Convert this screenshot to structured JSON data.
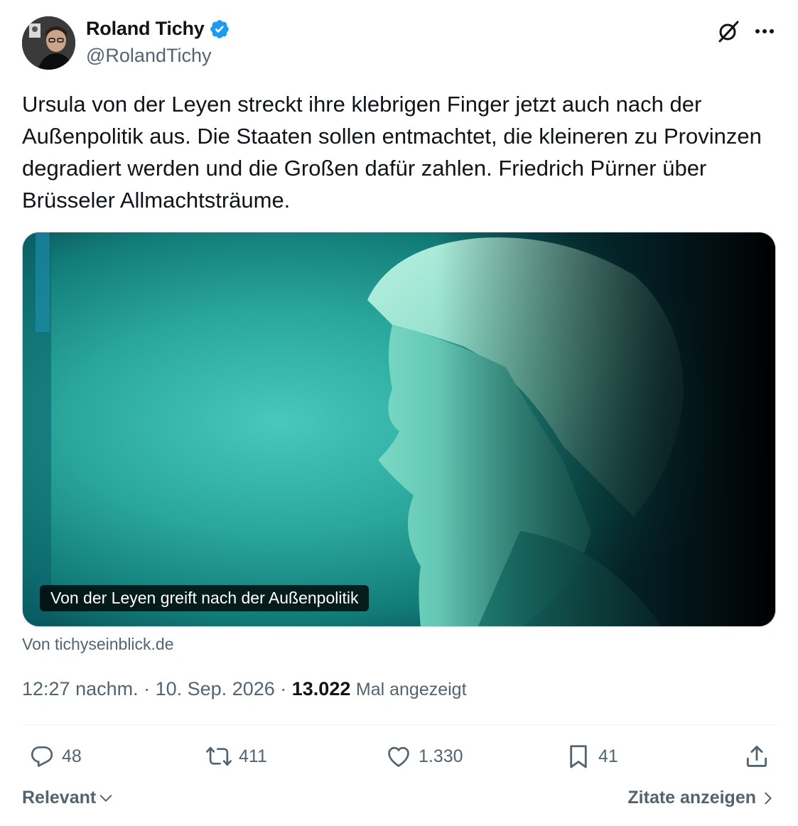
{
  "author": {
    "name": "Roland Tichy",
    "handle": "@RolandTichy",
    "verified": true
  },
  "tweet": {
    "text": "Ursula von der Leyen streckt ihre klebrigen Finger jetzt auch nach der Außenpolitik aus. Die Staaten sollen entmachtet, die kleineren zu Provinzen degradiert werden und die Großen dafür zahlen. Friedrich Pürner über Brüsseler Allmachtsträume."
  },
  "card": {
    "caption": "Von der Leyen greift nach der Außenpolitik",
    "source": "Von tichyseinblick.de"
  },
  "meta": {
    "time": "12:27 nachm.",
    "separator": " · ",
    "date": "10. Sep. 2026",
    "views": "13.022",
    "views_label": "Mal angezeigt"
  },
  "actions": {
    "replies": "48",
    "retweets": "411",
    "likes": "1.330",
    "bookmarks": "41"
  },
  "footer": {
    "sort_label": "Relevant",
    "quotes_label": "Zitate anzeigen"
  },
  "colors": {
    "text_primary": "#0f1419",
    "text_secondary": "#536471",
    "verified_blue": "#1d9bf0",
    "divider": "#eff3f4",
    "photo_teal": "#2fb3a6"
  },
  "icons": [
    "verified-badge-icon",
    "grok-icon",
    "more-icon",
    "reply-icon",
    "retweet-icon",
    "like-icon",
    "bookmark-icon",
    "share-icon",
    "chevron-down-icon",
    "chevron-right-icon"
  ]
}
